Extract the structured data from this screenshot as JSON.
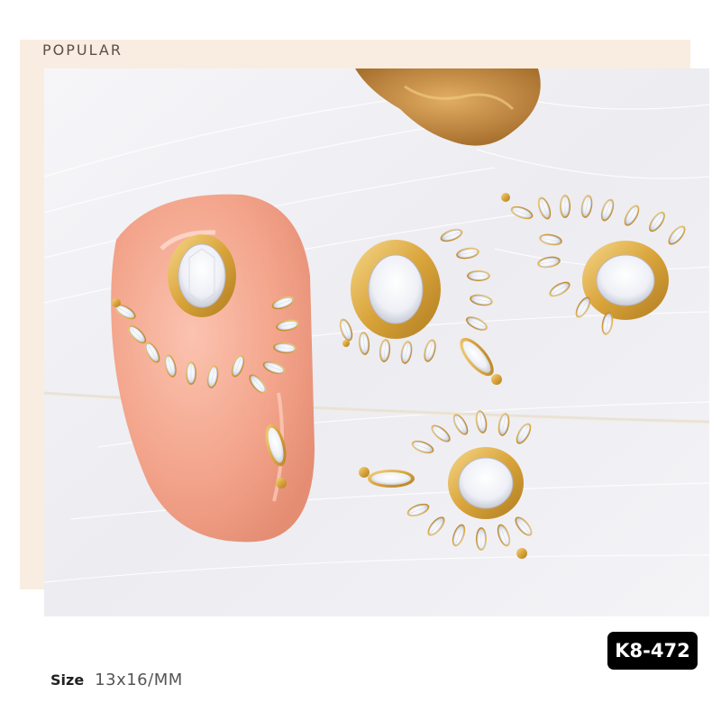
{
  "header": {
    "label": "POPULAR"
  },
  "product": {
    "code": "K8-472"
  },
  "size": {
    "label": "Size",
    "value": "13x16/MM"
  },
  "photo": {
    "subject": "gold zircon nail charms on feather background",
    "colors": {
      "gold": "#d9a43a",
      "nail": "#f4a48c",
      "feather": "#f2f2f6",
      "crystal": "#f6f6fa"
    }
  }
}
